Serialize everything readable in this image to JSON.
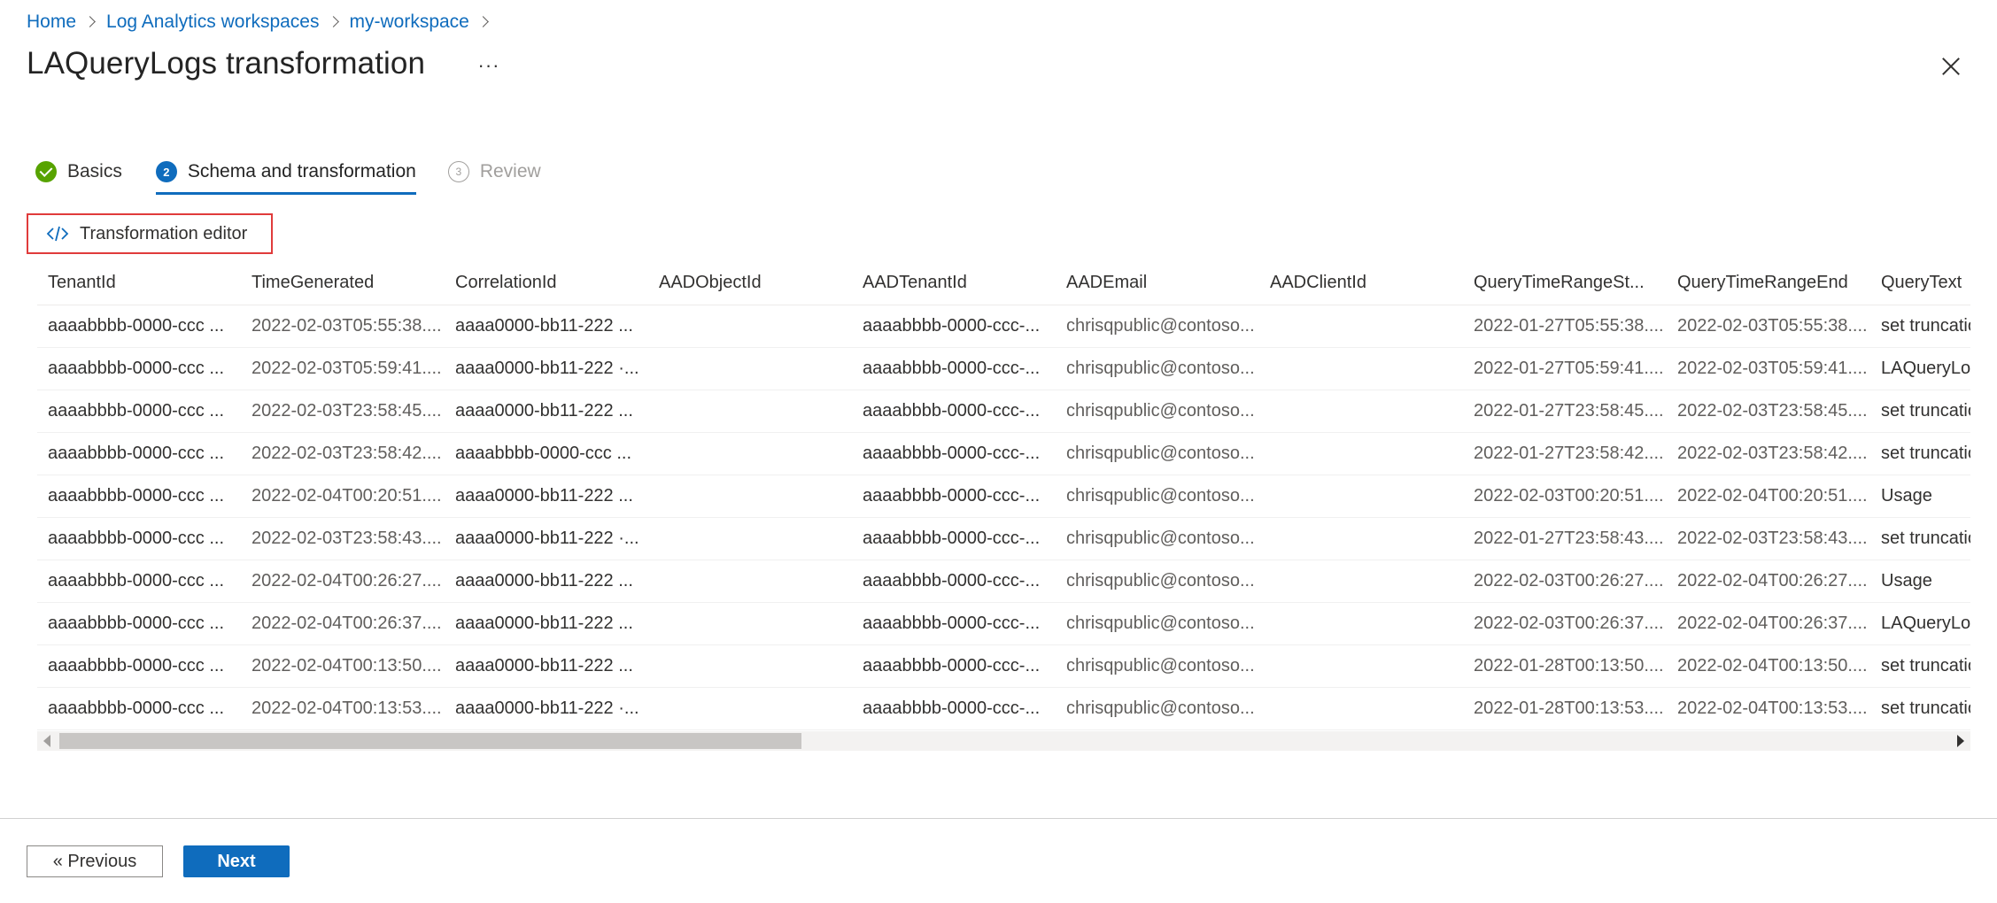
{
  "breadcrumb": {
    "items": [
      "Home",
      "Log Analytics workspaces",
      "my-workspace"
    ]
  },
  "header": {
    "title": "LAQueryLogs transformation",
    "more_label": "···"
  },
  "steps": [
    {
      "label": "Basics",
      "state": "complete"
    },
    {
      "label": "Schema and transformation",
      "number": "2",
      "state": "active"
    },
    {
      "label": "Review",
      "number": "3",
      "state": "inactive"
    }
  ],
  "toolbar": {
    "editor_label": "Transformation editor"
  },
  "table": {
    "columns": [
      "TenantId",
      "TimeGenerated",
      "CorrelationId",
      "AADObjectId",
      "AADTenantId",
      "AADEmail",
      "AADClientId",
      "QueryTimeRangeSt...",
      "QueryTimeRangeEnd",
      "QueryText"
    ],
    "rows": [
      [
        "aaaabbbb-0000-ccc ...",
        "2022-02-03T05:55:38....",
        "aaaa0000-bb11-222 ...",
        "",
        "aaaabbbb-0000-ccc-...",
        "chrisqpublic@contoso...",
        "",
        "2022-01-27T05:55:38....",
        "2022-02-03T05:55:38....",
        "set truncationmaxrec"
      ],
      [
        "aaaabbbb-0000-ccc ...",
        "2022-02-03T05:59:41....",
        "aaaa0000-bb11-222 ·...",
        "",
        "aaaabbbb-0000-ccc-...",
        "chrisqpublic@contoso...",
        "",
        "2022-01-27T05:59:41....",
        "2022-02-03T05:59:41....",
        "LAQueryLogs | take"
      ],
      [
        "aaaabbbb-0000-ccc ...",
        "2022-02-03T23:58:45....",
        "aaaa0000-bb11-222 ...",
        "",
        "aaaabbbb-0000-ccc-...",
        "chrisqpublic@contoso...",
        "",
        "2022-01-27T23:58:45....",
        "2022-02-03T23:58:45....",
        "set truncationmaxrec"
      ],
      [
        "aaaabbbb-0000-ccc ...",
        "2022-02-03T23:58:42....",
        "aaaabbbb-0000-ccc ...",
        "",
        "aaaabbbb-0000-ccc-...",
        "chrisqpublic@contoso...",
        "",
        "2022-01-27T23:58:42....",
        "2022-02-03T23:58:42....",
        "set truncationmaxrec"
      ],
      [
        "aaaabbbb-0000-ccc ...",
        "2022-02-04T00:20:51....",
        "aaaa0000-bb11-222 ...",
        "",
        "aaaabbbb-0000-ccc-...",
        "chrisqpublic@contoso...",
        "",
        "2022-02-03T00:20:51....",
        "2022-02-04T00:20:51....",
        "Usage"
      ],
      [
        "aaaabbbb-0000-ccc ...",
        "2022-02-03T23:58:43....",
        "aaaa0000-bb11-222 ·...",
        "",
        "aaaabbbb-0000-ccc-...",
        "chrisqpublic@contoso...",
        "",
        "2022-01-27T23:58:43....",
        "2022-02-03T23:58:43....",
        "set truncationmaxrec"
      ],
      [
        "aaaabbbb-0000-ccc ...",
        "2022-02-04T00:26:27....",
        "aaaa0000-bb11-222 ...",
        "",
        "aaaabbbb-0000-ccc-...",
        "chrisqpublic@contoso...",
        "",
        "2022-02-03T00:26:27....",
        "2022-02-04T00:26:27....",
        "Usage"
      ],
      [
        "aaaabbbb-0000-ccc ...",
        "2022-02-04T00:26:37....",
        "aaaa0000-bb11-222 ...",
        "",
        "aaaabbbb-0000-ccc-...",
        "chrisqpublic@contoso...",
        "",
        "2022-02-03T00:26:37....",
        "2022-02-04T00:26:37....",
        "LAQueryLogs"
      ],
      [
        "aaaabbbb-0000-ccc ...",
        "2022-02-04T00:13:50....",
        "aaaa0000-bb11-222 ...",
        "",
        "aaaabbbb-0000-ccc-...",
        "chrisqpublic@contoso...",
        "",
        "2022-01-28T00:13:50....",
        "2022-02-04T00:13:50....",
        "set truncationmaxrec"
      ],
      [
        "aaaabbbb-0000-ccc ...",
        "2022-02-04T00:13:53....",
        "aaaa0000-bb11-222 ·...",
        "",
        "aaaabbbb-0000-ccc-...",
        "chrisqpublic@contoso...",
        "",
        "2022-01-28T00:13:53....",
        "2022-02-04T00:13:53....",
        "set truncationmaxrec"
      ]
    ]
  },
  "footer": {
    "previous_label": "« Previous",
    "next_label": "Next"
  },
  "colors": {
    "accent": "#0f6cbd",
    "success": "#57a300",
    "highlight_border": "#e03b3b"
  }
}
